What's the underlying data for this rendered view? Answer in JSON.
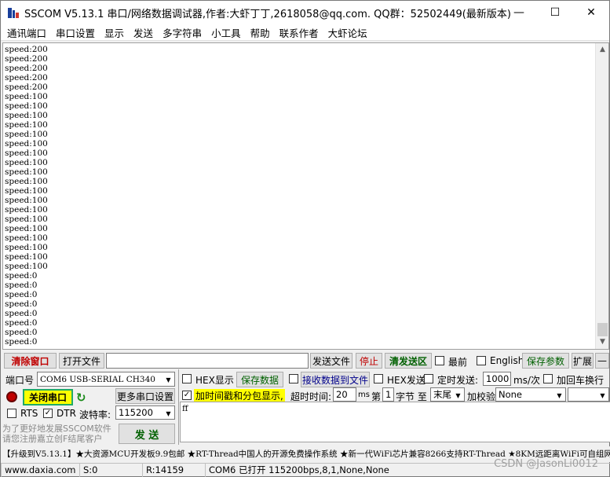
{
  "window": {
    "title": "SSCOM V5.13.1 串口/网络数据调试器,作者:大虾丁丁,2618058@qq.com. QQ群：52502449(最新版本)",
    "minimize": "—",
    "maximize": "☐",
    "close": "✕"
  },
  "menu": [
    "通讯端口",
    "串口设置",
    "显示",
    "发送",
    "多字符串",
    "小工具",
    "帮助",
    "联系作者",
    "大虾论坛"
  ],
  "receive": {
    "lines": [
      "speed:200",
      "speed:200",
      "speed:200",
      "speed:200",
      "speed:200",
      "speed:100",
      "speed:100",
      "speed:100",
      "speed:100",
      "speed:100",
      "speed:100",
      "speed:100",
      "speed:100",
      "speed:100",
      "speed:100",
      "speed:100",
      "speed:100",
      "speed:100",
      "speed:100",
      "speed:100",
      "speed:100",
      "speed:100",
      "speed:100",
      "speed:100",
      "speed:0",
      "speed:0",
      "speed:0",
      "speed:0",
      "speed:0",
      "speed:0",
      "speed:0",
      "speed:0"
    ]
  },
  "toolbar": {
    "clear_window": "清除窗口",
    "open_file": "打开文件",
    "file_path": "",
    "send_file": "发送文件",
    "stop": "停止",
    "clear_send": "清发送区",
    "topmost": "最前",
    "english": "English",
    "save_params": "保存参数",
    "expand": "扩展",
    "collapse": "—"
  },
  "port": {
    "port_label": "端口号",
    "port_value": "COM6 USB-SERIAL CH340",
    "hex_display": "HEX显示",
    "save_data": "保存数据",
    "recv_to_file": "接收数据到文件",
    "hex_send": "HEX发送",
    "timed_send": "定时发送:",
    "interval": "1000",
    "interval_unit": "ms/次",
    "add_crlf": "加回车换行",
    "close_port": "关闭串口",
    "more_settings": "更多串口设置",
    "timestamp": "加时间戳和分包显示,",
    "timeout_label": "超时时间:",
    "timeout_value": "20",
    "timeout_unit": "ms",
    "nth_label": "第",
    "nth_value": "1",
    "byte_label": "字节 至",
    "end_value": "末尾",
    "checksum_label": "加校验",
    "checksum_value": "None",
    "rts": "RTS",
    "dtr": "DTR",
    "baud_label": "波特率:",
    "baud_value": "115200",
    "send_button": "发  送",
    "send_text": "ff",
    "promo_line1": "为了更好地发展SSCOM软件",
    "promo_line2": "请您注册嘉立创F结尾客户"
  },
  "ticker": "【升级到V5.13.1】★大资源MCU开发板9.9包邮 ★RT-Thread中国人的开源免费操作系统 ★新一代WiFi芯片兼容8266支持RT-Thread ★8KM远距离WiFi可自组网",
  "status": {
    "site": "www.daxia.com",
    "sent": "S:0",
    "received": "R:14159",
    "port_state": "COM6 已打开  115200bps,8,1,None,None"
  },
  "watermark": "CSDN @JasonLi0012"
}
